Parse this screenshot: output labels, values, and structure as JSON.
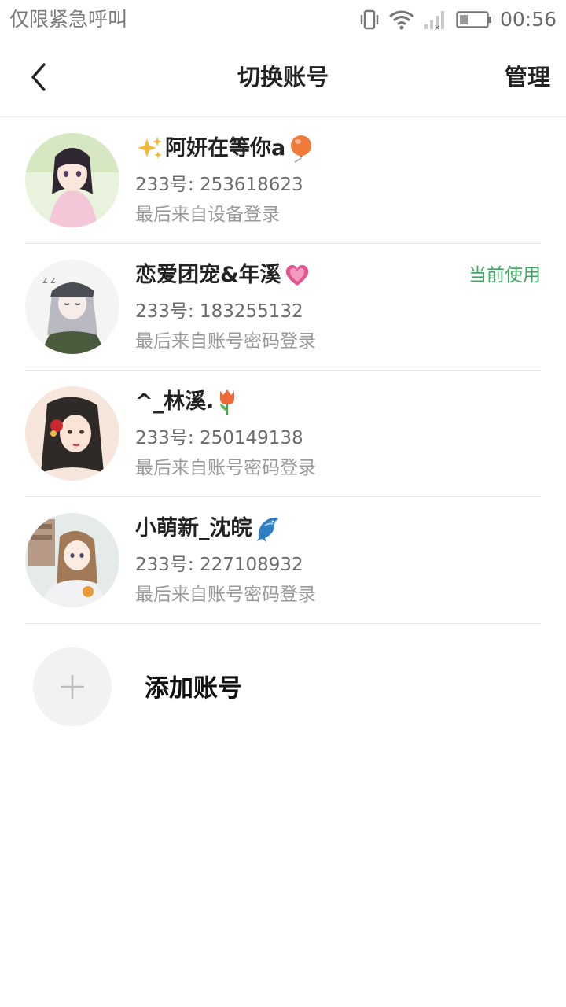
{
  "status_bar": {
    "carrier_text": "仅限紧急呼叫",
    "time": "00:56",
    "icons": [
      "vibrate-icon",
      "wifi-icon",
      "signal-icon",
      "battery-icon"
    ]
  },
  "header": {
    "title": "切换账号",
    "manage_label": "管理",
    "back_icon": "chevron-left-icon"
  },
  "accounts": [
    {
      "name": "阿妍在等你a",
      "id_text": "233号: 253618623",
      "login_text": "最后来自设备登录",
      "current": false,
      "badge": ""
    },
    {
      "name": "恋爱团宠&年溪",
      "id_text": "233号: 183255132",
      "login_text": "最后来自账号密码登录",
      "current": true,
      "badge": "当前使用"
    },
    {
      "name": "^_林溪.",
      "id_text": "233号: 250149138",
      "login_text": "最后来自账号密码登录",
      "current": false,
      "badge": ""
    },
    {
      "name": "小萌新_沈皖",
      "id_text": "233号: 227108932",
      "login_text": "最后来自账号密码登录",
      "current": false,
      "badge": ""
    }
  ],
  "add_account": {
    "label": "添加账号",
    "icon": "plus-icon"
  },
  "colors": {
    "accent_green": "#3aa860",
    "divider": "#e6e6e6",
    "title": "#222222",
    "secondary_text": "#6b6b6b",
    "tertiary_text": "#9a9a9a"
  }
}
